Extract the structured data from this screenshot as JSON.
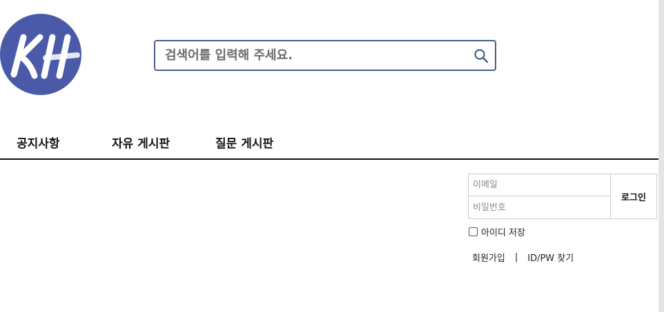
{
  "logo": {
    "text": "KH",
    "color": "#4a5aa8"
  },
  "search": {
    "placeholder": "검색어를 입력해 주세요.",
    "value": "",
    "icon": "search-icon"
  },
  "nav": {
    "items": [
      {
        "label": "공지사항"
      },
      {
        "label": "자유 게시판"
      },
      {
        "label": "질문 게시판"
      }
    ]
  },
  "login": {
    "email_placeholder": "이메일",
    "password_placeholder": "비밀번호",
    "login_label": "로그인",
    "remember_label": "아이디 저장",
    "signup_label": "회원가입",
    "separator": "|",
    "find_label": "ID/PW 찾기"
  },
  "colors": {
    "accent": "#4a5aa8",
    "search_border": "#4a5a8e"
  }
}
